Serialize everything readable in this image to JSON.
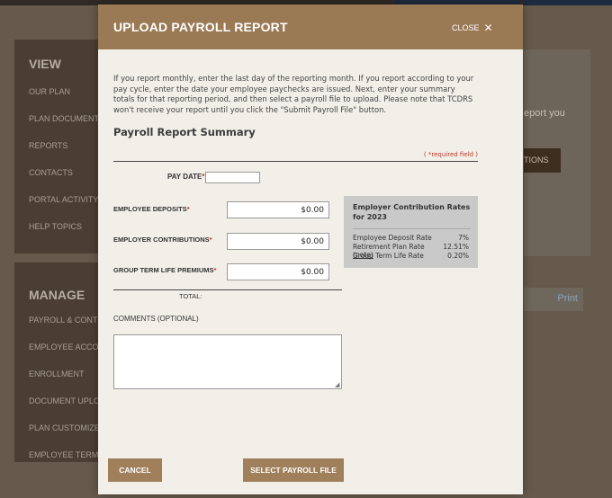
{
  "background": {
    "sidebar": {
      "view_title": "VIEW",
      "view_items": [
        "OUR PLAN",
        "PLAN DOCUMENTS",
        "REPORTS",
        "CONTACTS",
        "PORTAL ACTIVITY",
        "HELP TOPICS"
      ],
      "manage_title": "MANAGE",
      "manage_items": [
        "PAYROLL & CONTRIBUTIONS",
        "EMPLOYEE ACCOUNTS",
        "ENROLLMENT",
        "DOCUMENT UPLOADS",
        "PLAN CUSTOMIZER",
        "EMPLOYEE TERMINATIONS"
      ]
    },
    "right_text": "eport you",
    "right_button": "TIONS",
    "print_label": "Print"
  },
  "modal": {
    "title": "UPLOAD PAYROLL REPORT",
    "close_label": "CLOSE",
    "close_icon": "close-x-icon",
    "intro": "If you report monthly, enter the last day of the reporting month. If you report according to your pay cycle, enter the date your employee paychecks are issued. Next, enter your summary totals for that reporting period, and then select a payroll file to upload. Please note that TCDRS won't receive your report until you click the \"Submit Payroll File\" button.",
    "section_title": "Payroll Report Summary",
    "required_note": "( *required field )",
    "pay_date_label": "PAY DATE",
    "pay_date_value": "",
    "employee_deposits_label": "EMPLOYEE DEPOSITS",
    "employee_deposits_value": "$0.00",
    "employer_contributions_label": "EMPLOYER CONTRIBUTIONS",
    "employer_contributions_value": "$0.00",
    "group_term_label": "GROUP TERM LIFE PREMIUMS",
    "group_term_value": "$0.00",
    "total_label": "TOTAL:",
    "comments_label": "COMMENTS (OPTIONAL)",
    "comments_value": "",
    "rates": {
      "title": "Employer Contribution Rates for 2023",
      "rows": [
        {
          "label": "Employee Deposit Rate",
          "value": "7%"
        },
        {
          "label": "Retirement Plan Rate",
          "note": "(note)",
          "value": "12.51%"
        },
        {
          "label": "Group Term Life Rate",
          "value": "0.20%"
        }
      ]
    },
    "cancel_label": "CANCEL",
    "select_label": "SELECT PAYROLL FILE"
  },
  "colors": {
    "header": "#9a7a55",
    "button": "#a0805b",
    "modal_bg": "#f1efe8",
    "required": "#c0392b",
    "rates_bg": "#c9c9c9"
  }
}
